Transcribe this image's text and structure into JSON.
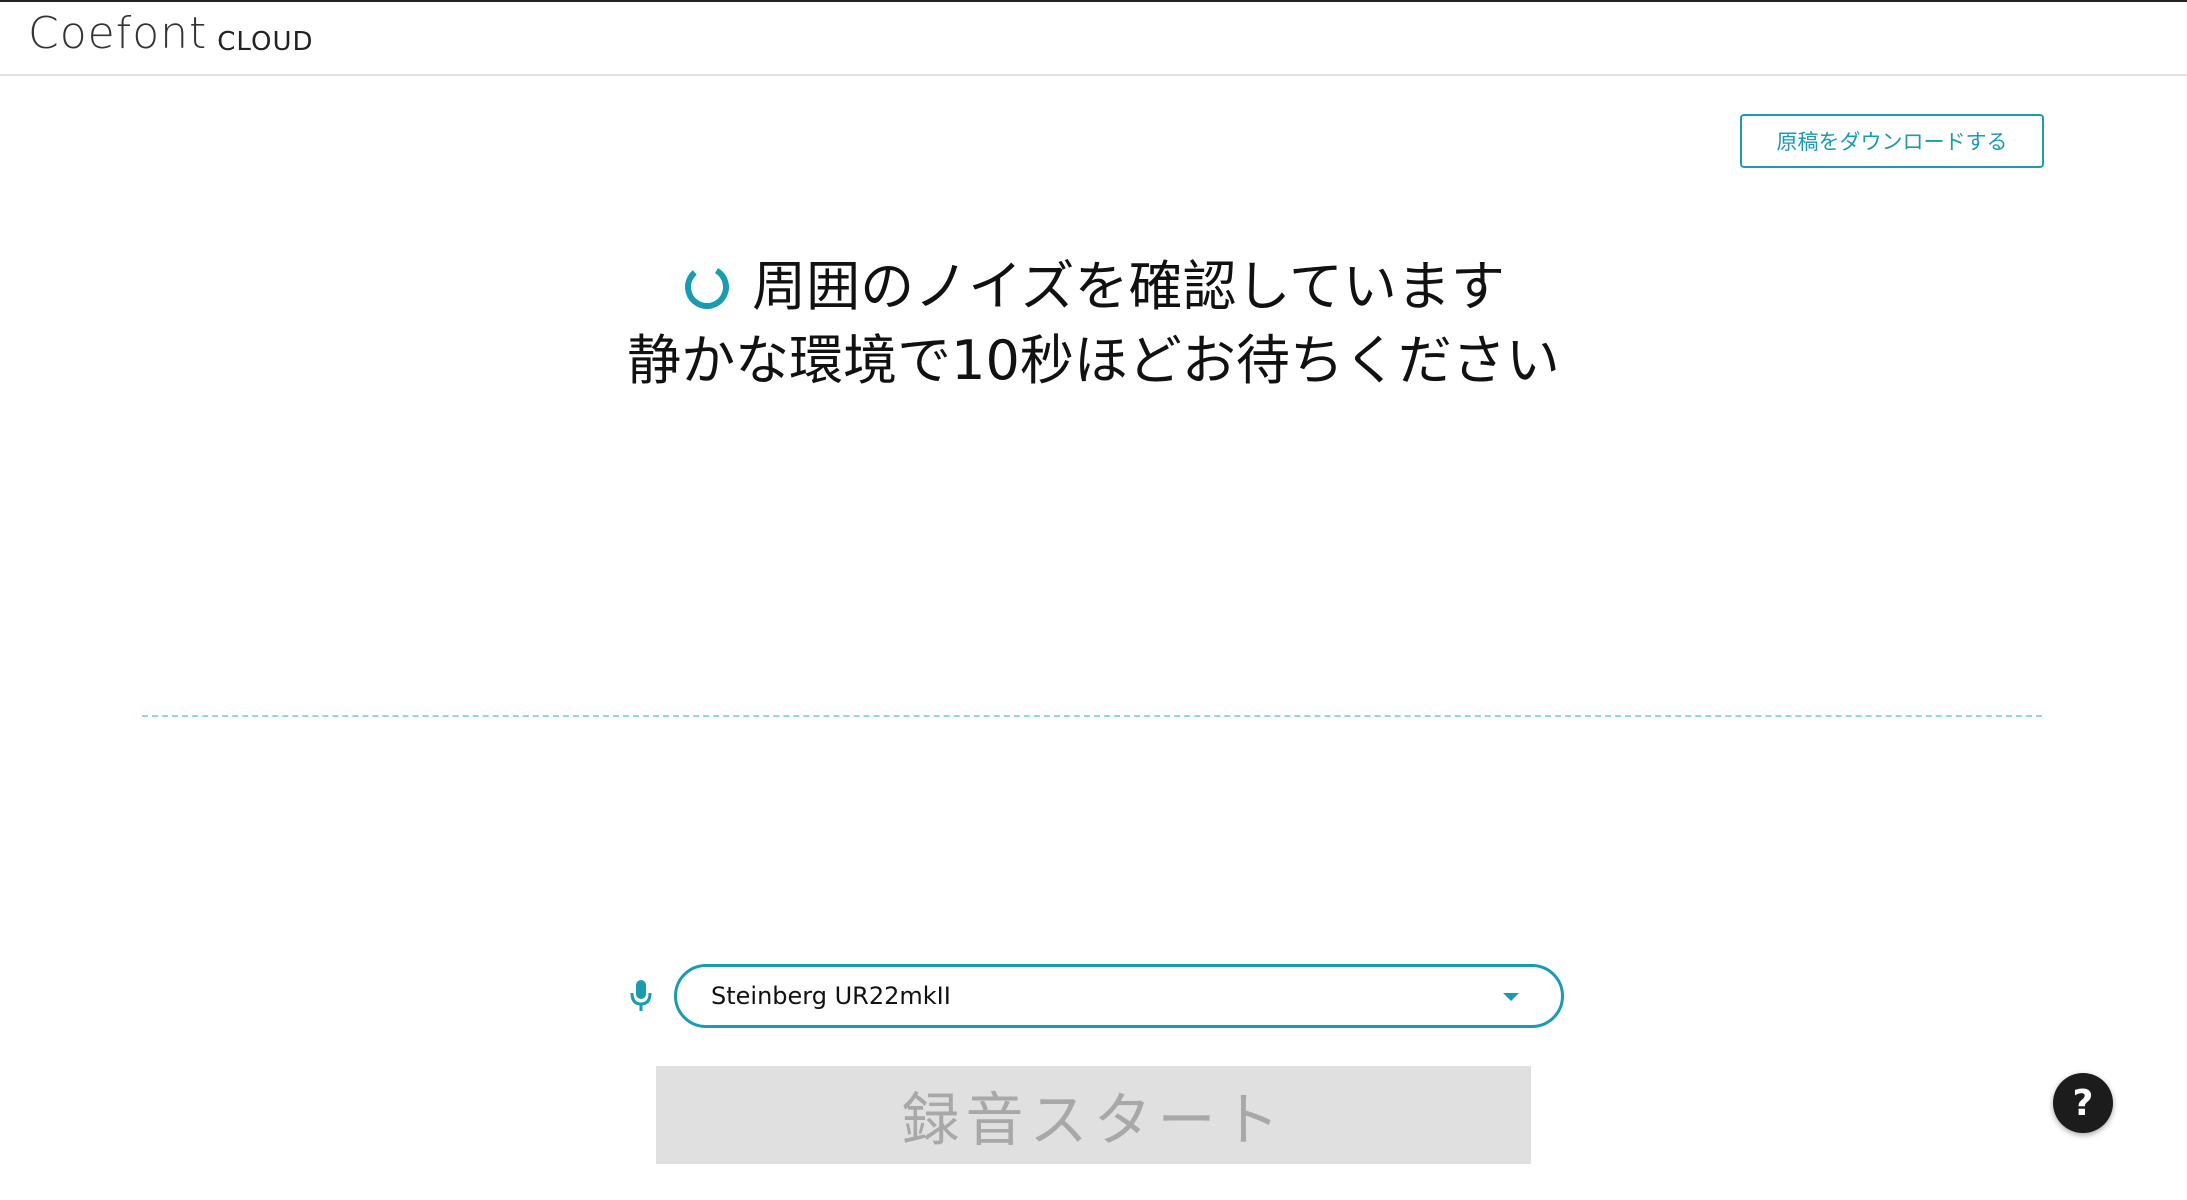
{
  "header": {
    "logo_main": "Coefont",
    "logo_sub": "CLOUD"
  },
  "toolbar": {
    "download_label": "原稿をダウンロードする"
  },
  "status": {
    "line1": "周囲のノイズを確認しています",
    "line2": "静かな環境で10秒ほどお待ちください"
  },
  "device": {
    "selected": "Steinberg UR22mkII",
    "icon": "microphone-icon"
  },
  "record": {
    "label": "録音スタート",
    "enabled": false
  },
  "help": {
    "label": "?"
  },
  "colors": {
    "accent": "#1a9bb0",
    "divider": "#8ed8e0",
    "disabled_bg": "#e0e0e0",
    "disabled_text": "#a8a8a8",
    "help_bg": "#1c1c1c"
  }
}
